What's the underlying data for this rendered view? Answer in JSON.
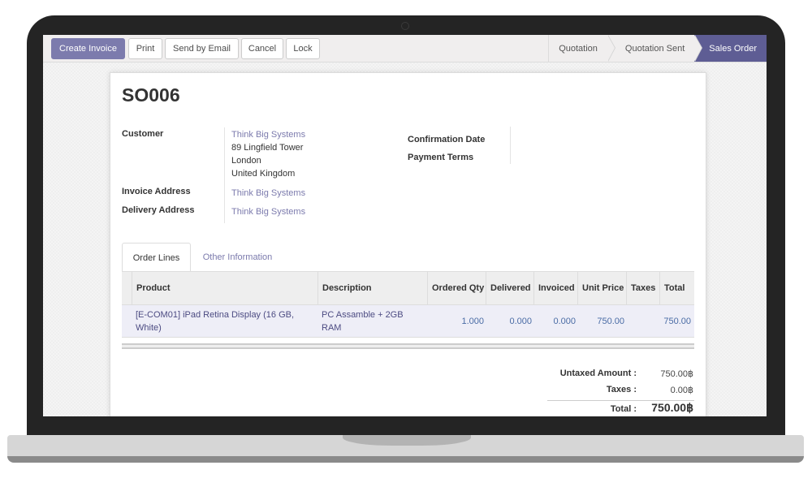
{
  "toolbar": {
    "buttons": [
      {
        "label": "Create Invoice",
        "primary": true
      },
      {
        "label": "Print"
      },
      {
        "label": "Send by Email"
      },
      {
        "label": "Cancel"
      },
      {
        "label": "Lock"
      }
    ]
  },
  "statusbar": {
    "stages": [
      {
        "label": "Quotation",
        "active": false
      },
      {
        "label": "Quotation Sent",
        "active": false
      },
      {
        "label": "Sales Order",
        "active": true
      }
    ]
  },
  "order": {
    "title": "SO006",
    "fields": {
      "customer_label": "Customer",
      "customer_name": "Think Big Systems",
      "customer_address": [
        "89 Lingfield Tower",
        "London",
        "United Kingdom"
      ],
      "invoice_address_label": "Invoice Address",
      "invoice_address": "Think Big Systems",
      "delivery_address_label": "Delivery Address",
      "delivery_address": "Think Big Systems",
      "confirmation_date_label": "Confirmation Date",
      "confirmation_date": "",
      "payment_terms_label": "Payment Terms",
      "payment_terms": ""
    }
  },
  "tabs": [
    {
      "label": "Order Lines",
      "active": true
    },
    {
      "label": "Other Information",
      "active": false
    }
  ],
  "order_lines": {
    "columns": [
      "Product",
      "Description",
      "Ordered Qty",
      "Delivered",
      "Invoiced",
      "Unit Price",
      "Taxes",
      "Total"
    ],
    "rows": [
      {
        "product": "[E-COM01] iPad Retina Display (16 GB, White)",
        "description": "PC Assamble + 2GB RAM",
        "ordered_qty": "1.000",
        "delivered": "0.000",
        "invoiced": "0.000",
        "unit_price": "750.00",
        "taxes": "",
        "total": "750.00"
      }
    ]
  },
  "totals": {
    "untaxed_label": "Untaxed Amount :",
    "untaxed_value": "750.00฿",
    "taxes_label": "Taxes :",
    "taxes_value": "0.00฿",
    "total_label": "Total :",
    "total_value": "750.00฿"
  },
  "colors": {
    "primary": "#7c7bad",
    "active_stage": "#5e5d94",
    "link": "#7c7bad"
  }
}
